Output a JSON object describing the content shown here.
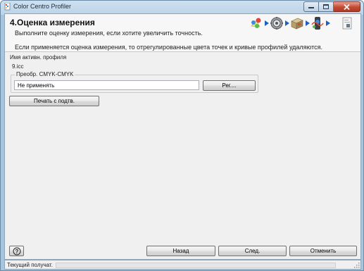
{
  "window": {
    "title": "Color Centro Profiler"
  },
  "header": {
    "step_title": "4.Оценка измерения",
    "description": "Выполните оценку измерения, если хотите увеличить точность.",
    "note": "Если применяется оценка измерения, то отрегулированные цвета точек и кривые профилей удаляются.",
    "steps": [
      {
        "icon": "print-color-icon"
      },
      {
        "icon": "measurement-settings-icon"
      },
      {
        "icon": "printer-box-icon"
      },
      {
        "icon": "profile-evaluation-icon"
      },
      {
        "icon": "document-save-icon"
      }
    ]
  },
  "main": {
    "active_profile_label": "Имя активн. профиля",
    "active_profile_value": "9.icc",
    "cmyk_group_label": "Преобр. CMYK-CMYK",
    "cmyk_field_value": "Не применять",
    "adjust_button": "Рег....",
    "print_button": "Печать с подтв."
  },
  "footer": {
    "help_icon": "help-icon",
    "back_button": "Назад",
    "next_button": "След.",
    "cancel_button": "Отменить"
  },
  "status": {
    "text": "Текущий получат.",
    "progress": 0
  },
  "colors": {
    "title_bar": "#bcd3e8",
    "close_button": "#c34a33",
    "client_bg": "#f0f0f0",
    "step_arrow": "#1f5fbf"
  }
}
